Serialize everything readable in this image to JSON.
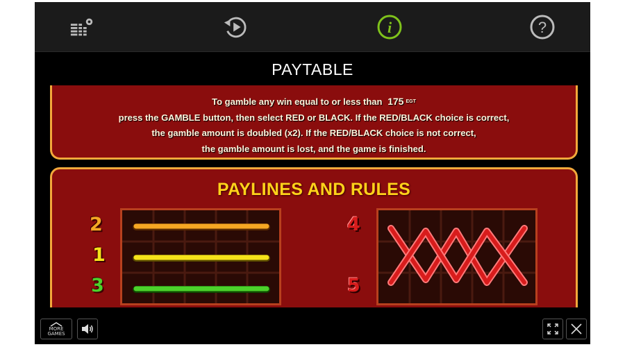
{
  "topbar": {
    "icons": [
      "settings-icon",
      "history-icon",
      "info-icon",
      "help-icon"
    ],
    "active": "info-icon",
    "accent_color": "#7fc21b"
  },
  "page_title": "PAYTABLE",
  "gamble_panel": {
    "line1_prefix": "To gamble any win equal to or less than",
    "amount": "175",
    "currency": "EGT",
    "line2": "press the GAMBLE button, then select RED or BLACK. If the RED/BLACK choice is correct,",
    "line3": "the gamble amount is doubled (x2). If the RED/BLACK choice is not correct,",
    "line4": "the gamble amount is lost, and the game is finished."
  },
  "paylines_panel": {
    "title": "PAYLINES AND RULES",
    "left_grid_numbers": [
      "2",
      "1",
      "3"
    ],
    "right_grid_numbers": [
      "4",
      "5"
    ],
    "line_colors": {
      "line2": "#f5a623",
      "line1": "#f5e21a",
      "line3": "#4cd22b",
      "line4": "#d81c1c",
      "line5": "#d81c1c"
    }
  },
  "bottombar": {
    "more_games_label_1": "MORE",
    "more_games_label_2": "GAMES",
    "icons": [
      "more-games-icon",
      "sound-icon",
      "fullscreen-icon",
      "close-icon"
    ]
  }
}
